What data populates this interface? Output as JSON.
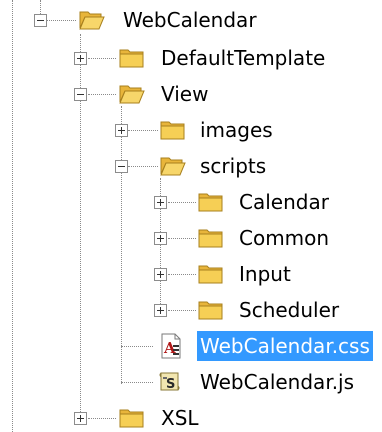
{
  "tree": {
    "nodes": [
      {
        "label": "WebCalendar",
        "state": "expanded",
        "icon": "folder-open-icon"
      },
      {
        "label": "DefaultTemplate",
        "state": "collapsed",
        "icon": "folder-icon"
      },
      {
        "label": "View",
        "state": "expanded",
        "icon": "folder-open-icon"
      },
      {
        "label": "images",
        "state": "collapsed",
        "icon": "folder-icon"
      },
      {
        "label": "scripts",
        "state": "expanded",
        "icon": "folder-open-icon"
      },
      {
        "label": "Calendar",
        "state": "collapsed",
        "icon": "folder-icon"
      },
      {
        "label": "Common",
        "state": "collapsed",
        "icon": "folder-icon"
      },
      {
        "label": "Input",
        "state": "collapsed",
        "icon": "folder-icon"
      },
      {
        "label": "Scheduler",
        "state": "collapsed",
        "icon": "folder-icon"
      },
      {
        "label": "WebCalendar.css",
        "state": "leaf",
        "icon": "css-file-icon",
        "selected": true
      },
      {
        "label": "WebCalendar.js",
        "state": "leaf",
        "icon": "js-file-icon"
      },
      {
        "label": "XSL",
        "state": "collapsed",
        "icon": "folder-icon"
      }
    ]
  },
  "colors": {
    "selection": "#3399ff",
    "folder": "#f1c644",
    "connector": "#8a8a8a"
  }
}
